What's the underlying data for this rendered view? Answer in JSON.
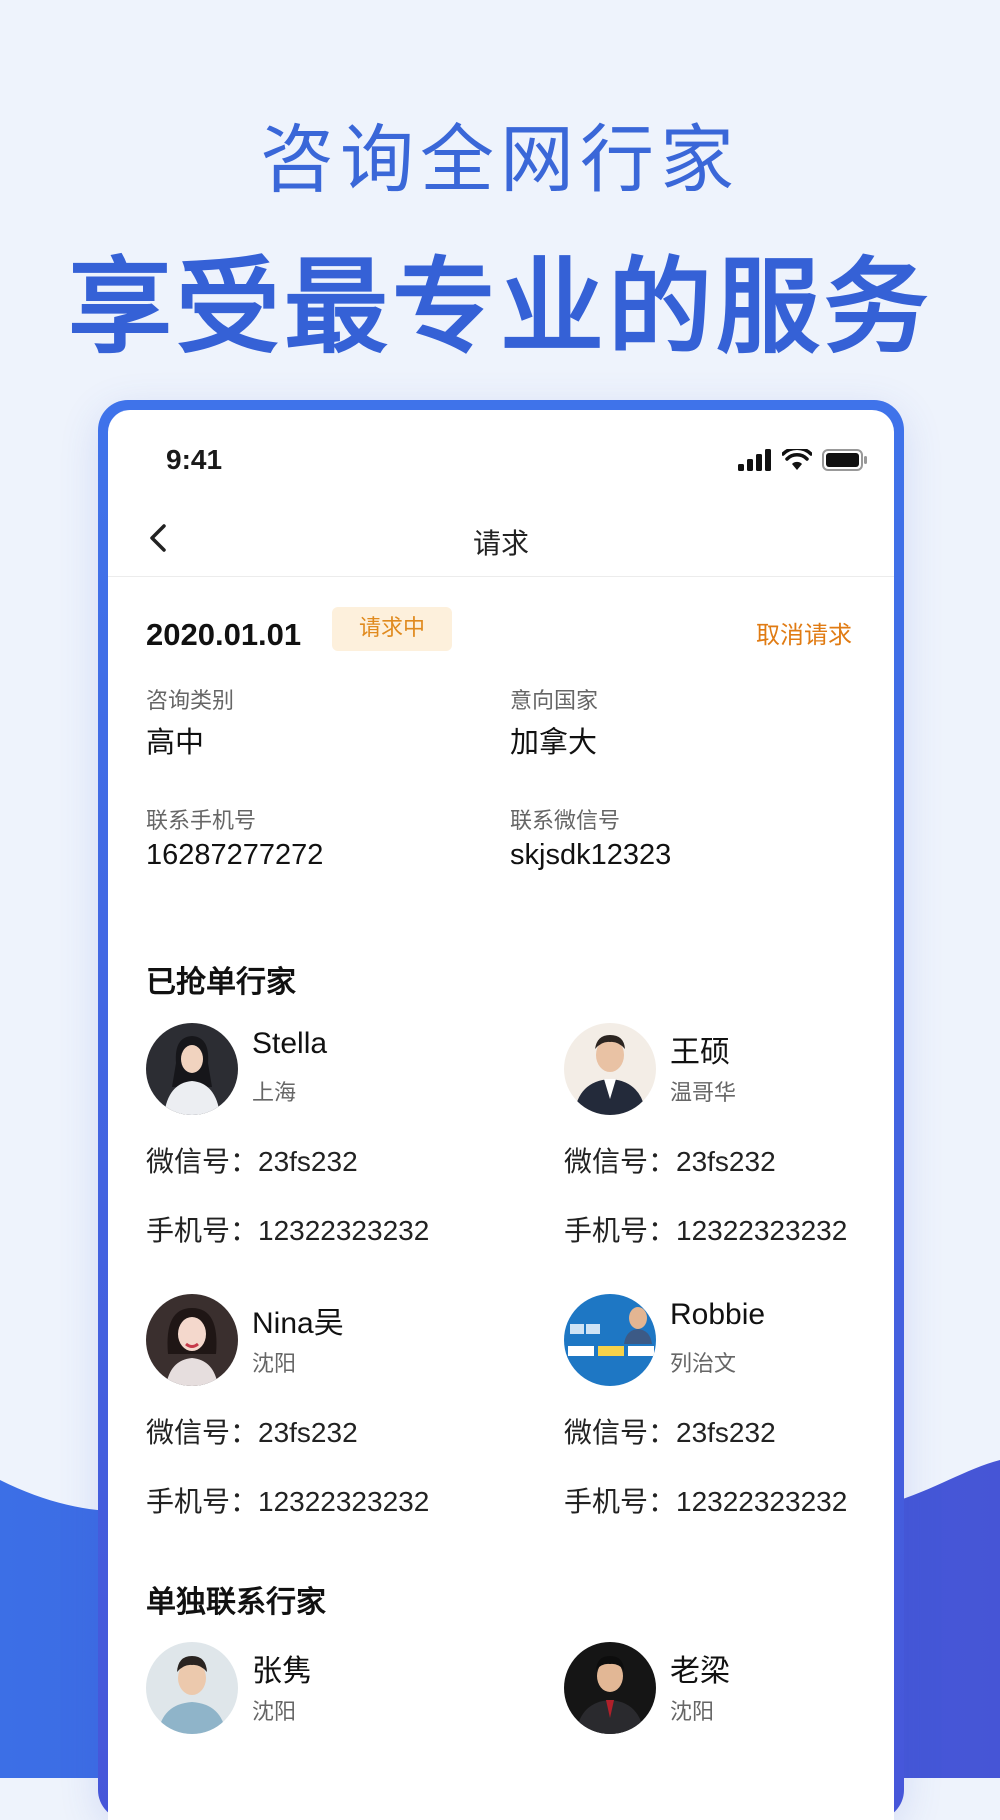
{
  "hero": {
    "line1": "咨询全网行家",
    "line2": "享受最专业的服务"
  },
  "status_bar": {
    "time": "9:41",
    "icons": [
      "signal-icon",
      "wifi-icon",
      "battery-icon"
    ]
  },
  "nav": {
    "title": "请求",
    "back_icon": "chevron-left-icon"
  },
  "request": {
    "date": "2020.01.01",
    "status": "请求中",
    "cancel_label": "取消请求",
    "fields": [
      {
        "label": "咨询类别",
        "value": "高中"
      },
      {
        "label": "意向国家",
        "value": "加拿大"
      },
      {
        "label": "联系手机号",
        "value": "16287277272"
      },
      {
        "label": "联系微信号",
        "value": "skjsdk12323"
      }
    ]
  },
  "grabbed": {
    "title": "已抢单行家",
    "experts": [
      {
        "name": "Stella",
        "city": "上海",
        "wechat": "微信号：23fs232",
        "phone": "手机号：12322323232"
      },
      {
        "name": "王硕",
        "city": "温哥华",
        "wechat": "微信号：23fs232",
        "phone": "手机号：12322323232"
      },
      {
        "name": "Nina吴",
        "city": "沈阳",
        "wechat": "微信号：23fs232",
        "phone": "手机号：12322323232"
      },
      {
        "name": "Robbie",
        "city": "列治文",
        "wechat": "微信号：23fs232",
        "phone": "手机号：12322323232"
      }
    ]
  },
  "direct": {
    "title": "单独联系行家",
    "experts": [
      {
        "name": "张隽",
        "city": "沈阳"
      },
      {
        "name": "老梁",
        "city": "沈阳"
      }
    ]
  },
  "colors": {
    "brand": "#3561d6",
    "background": "#eef3fc",
    "badge_bg": "#fdf0dc",
    "badge_text": "#e08a1e",
    "cancel_text": "#e07b13"
  }
}
